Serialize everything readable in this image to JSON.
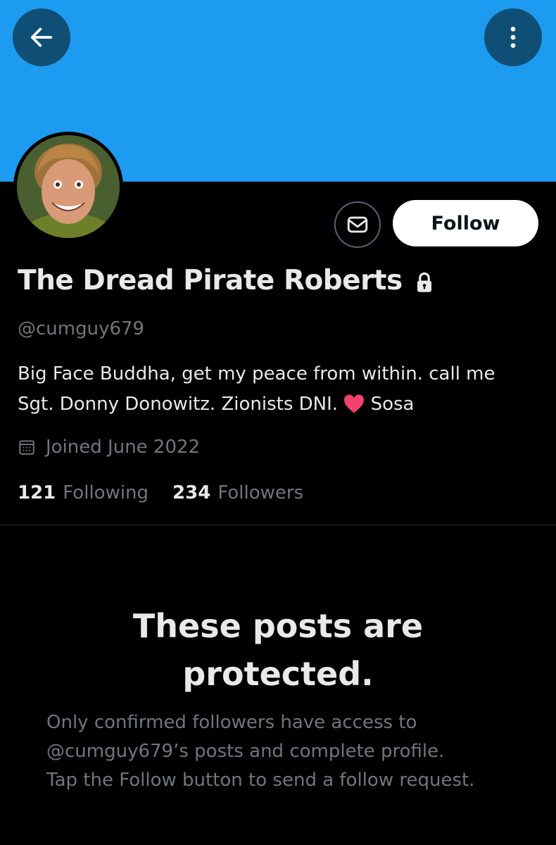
{
  "header": {
    "back_icon": "arrow-left-icon",
    "more_icon": "vertical-ellipsis-icon",
    "banner_color": "#1d9bf0"
  },
  "profile": {
    "display_name": "The Dread Pirate Roberts",
    "protected_icon": "lock-icon",
    "handle": "@cumguy679",
    "bio_line1": "Big Face Buddha, get my peace from within. call me",
    "bio_line2_pre": "Sgt. Donny Donowitz. Zionists DNI.",
    "bio_emoji": "❤️",
    "bio_line2_post": "Sosa",
    "joined": "Joined June 2022",
    "following_count": "121",
    "following_label": "Following",
    "followers_count": "234",
    "followers_label": "Followers"
  },
  "actions": {
    "message_icon": "mail-icon",
    "follow_label": "Follow"
  },
  "protected_notice": {
    "title_line1": "These posts are",
    "title_line2": "protected.",
    "line1": "Only confirmed followers have access to",
    "line2": "@cumguy679’s posts and complete profile.",
    "line3": "Tap the Follow button to send a follow request."
  }
}
